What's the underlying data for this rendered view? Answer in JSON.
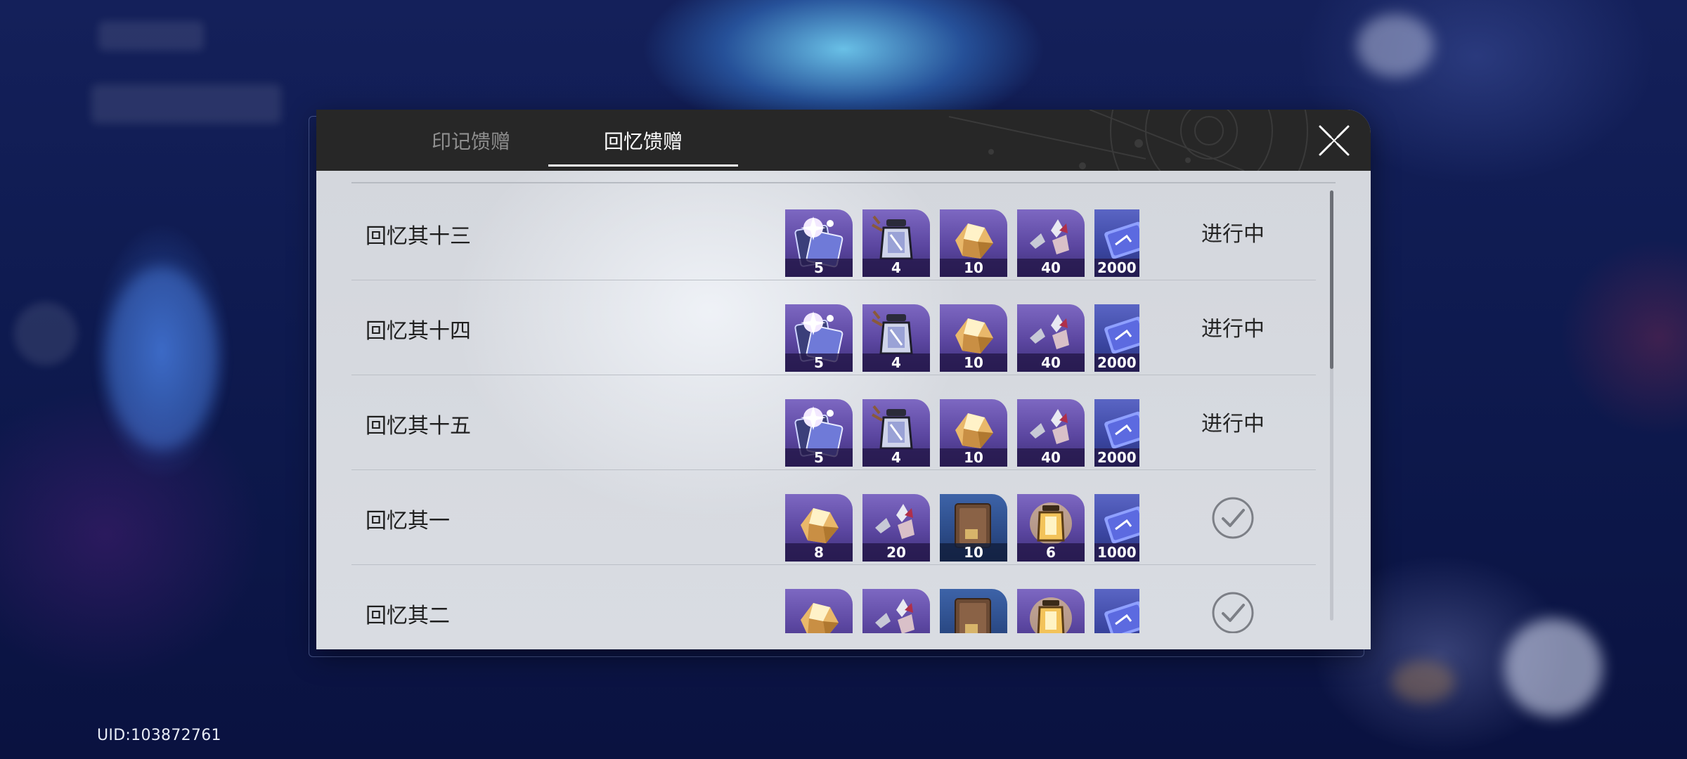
{
  "uid": "UID:103872761",
  "tabs": [
    {
      "label": "印记馈赠",
      "active": false
    },
    {
      "label": "回忆馈赠",
      "active": true
    }
  ],
  "rows": [
    {
      "title": "回忆其十三",
      "status": "进行中",
      "claimed": false,
      "items": [
        {
          "icon": "ticket-pack-icon",
          "qty": "5"
        },
        {
          "icon": "lantern-icon",
          "qty": "4"
        },
        {
          "icon": "gold-crystal-icon",
          "qty": "10"
        },
        {
          "icon": "shard-icon",
          "qty": "40"
        },
        {
          "icon": "coin-icon",
          "qty": "2000"
        }
      ]
    },
    {
      "title": "回忆其十四",
      "status": "进行中",
      "claimed": false,
      "items": [
        {
          "icon": "ticket-pack-icon",
          "qty": "5"
        },
        {
          "icon": "lantern-icon",
          "qty": "4"
        },
        {
          "icon": "gold-crystal-icon",
          "qty": "10"
        },
        {
          "icon": "shard-icon",
          "qty": "40"
        },
        {
          "icon": "coin-icon",
          "qty": "2000"
        }
      ]
    },
    {
      "title": "回忆其十五",
      "status": "进行中",
      "claimed": false,
      "items": [
        {
          "icon": "ticket-pack-icon",
          "qty": "5"
        },
        {
          "icon": "lantern-icon",
          "qty": "4"
        },
        {
          "icon": "gold-crystal-icon",
          "qty": "10"
        },
        {
          "icon": "shard-icon",
          "qty": "40"
        },
        {
          "icon": "coin-icon",
          "qty": "2000"
        }
      ]
    },
    {
      "title": "回忆其一",
      "status": "",
      "claimed": true,
      "items": [
        {
          "icon": "gold-crystal-icon",
          "qty": "8"
        },
        {
          "icon": "shard-icon",
          "qty": "20"
        },
        {
          "icon": "book-icon",
          "qty": "10"
        },
        {
          "icon": "golden-lantern-icon",
          "qty": "6"
        },
        {
          "icon": "coin-icon",
          "qty": "1000"
        }
      ]
    },
    {
      "title": "回忆其二",
      "status": "",
      "claimed": true,
      "items": [
        {
          "icon": "gold-crystal-icon",
          "qty": ""
        },
        {
          "icon": "shard-icon",
          "qty": ""
        },
        {
          "icon": "book-icon",
          "qty": ""
        },
        {
          "icon": "golden-lantern-icon",
          "qty": ""
        },
        {
          "icon": "coin-icon",
          "qty": ""
        }
      ]
    }
  ],
  "scroll_position": 0
}
